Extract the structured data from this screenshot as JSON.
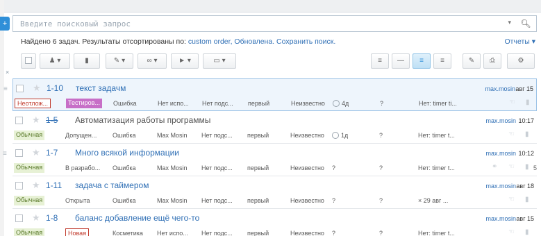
{
  "search": {
    "placeholder": "Введите поисковый запрос",
    "caret": "▾",
    "button_icon": "search-icon"
  },
  "summary": {
    "prefix": "Найдено 6 задач. Результаты отсортированы по:",
    "sort": "custom order",
    "refreshed": "Обновлена.",
    "save": "Сохранить поиск.",
    "reports": "Отчеты ▾"
  },
  "close_label": "×",
  "tasks": [
    {
      "id": "1-10",
      "title": "текст задачм",
      "done": false,
      "selected": true,
      "author": "max.mosin",
      "time": "авг 15",
      "priority": "Неотлож...",
      "priority_style": "urgent",
      "status": "Тестиров...",
      "status_style": "testing",
      "type": "Ошибка",
      "assignee": "Нет испо...",
      "milestone": "Нет подс...",
      "queue": "первый",
      "deadline": "Неизвестно",
      "estimate": "4д",
      "spent": "?",
      "timer": "Нет: timer ti...",
      "comments": ""
    },
    {
      "id": "1-5",
      "title": "Автоматизация работы программы",
      "done": true,
      "selected": false,
      "author": "max.mosin",
      "time": "10:17",
      "priority": "Обычная",
      "priority_style": "normal",
      "status": "Допущен...",
      "status_style": "plain",
      "type": "Ошибка",
      "assignee": "Max Mosin",
      "milestone": "Нет подс...",
      "queue": "первый",
      "deadline": "Неизвестно",
      "estimate": "1д",
      "spent": "?",
      "timer": "Нет: timer t...",
      "comments": ""
    },
    {
      "id": "1-7",
      "title": "Много всякой информации",
      "done": false,
      "selected": false,
      "author": "max.mosin",
      "time": "10:12",
      "priority": "Обычная",
      "priority_style": "normal",
      "status": "В разрабо...",
      "status_style": "plain",
      "type": "Ошибка",
      "assignee": "Max Mosin",
      "milestone": "Нет подс...",
      "queue": "первый",
      "deadline": "Неизвестно",
      "estimate": "?",
      "spent": "?",
      "timer": "Нет: timer t...",
      "comments": "5"
    },
    {
      "id": "1-11",
      "title": "задача с таймером",
      "done": false,
      "selected": false,
      "author": "max.mosin",
      "time": "авг 18",
      "priority": "Обычная",
      "priority_style": "normal",
      "status": "Открыта",
      "status_style": "plain",
      "type": "Ошибка",
      "assignee": "Max Mosin",
      "milestone": "Нет подс...",
      "queue": "первый",
      "deadline": "Неизвестно",
      "estimate": "?",
      "spent": "?",
      "timer": "× 29 авг ...",
      "comments": ""
    },
    {
      "id": "1-8",
      "title": "баланс добавление ещё чего-то",
      "done": false,
      "selected": false,
      "author": "max.mosin",
      "time": "авг 15",
      "priority": "Обычная",
      "priority_style": "normal",
      "status": "Новая",
      "status_style": "new",
      "type": "Косметика",
      "assignee": "Нет испо...",
      "milestone": "Нет подс...",
      "queue": "первый",
      "deadline": "Неизвестно",
      "estimate": "?",
      "spent": "?",
      "timer": "Нет: timer t...",
      "comments": ""
    }
  ],
  "colors": {
    "accent": "#2f8fd8",
    "link": "#2f6fb5",
    "normal": "#e7f1d5",
    "testing": "#c76fc7",
    "urgent": "#c0392b"
  }
}
